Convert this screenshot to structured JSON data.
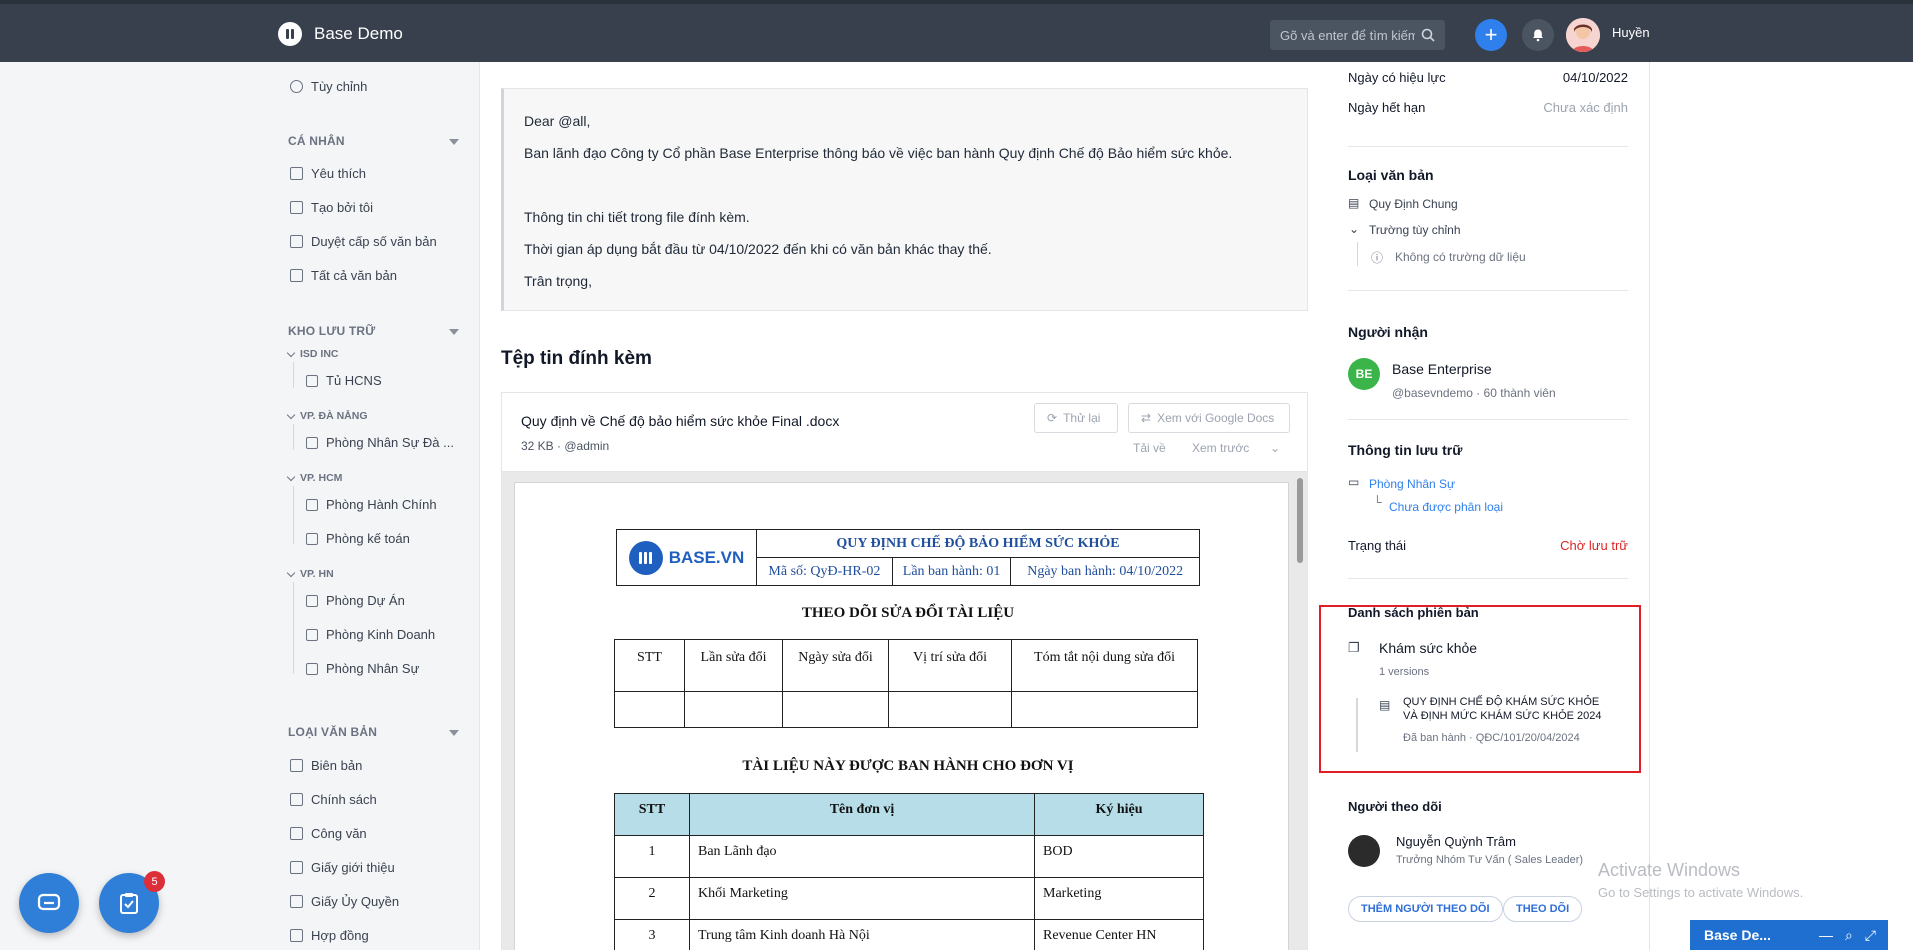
{
  "app": {
    "title": "Base Demo",
    "username": "Huyền"
  },
  "search": {
    "placeholder": "Gõ và enter để tìm kiếm"
  },
  "sidebar": {
    "top_item": "Tùy chỉnh",
    "personal": {
      "heading": "CÁ NHÂN",
      "items": [
        "Yêu thích",
        "Tạo bởi tôi",
        "Duyệt cấp số văn bản",
        "Tất cả văn bản"
      ]
    },
    "storage": {
      "heading": "KHO LƯU TRỮ",
      "groups": [
        {
          "name": "ISD INC",
          "items": [
            "Tủ HCNS"
          ]
        },
        {
          "name": "VP. ĐÀ NẴNG",
          "items": [
            "Phòng Nhân Sự Đà ..."
          ]
        },
        {
          "name": "VP. HCM",
          "items": [
            "Phòng Hành Chính",
            "Phòng kế toán"
          ]
        },
        {
          "name": "VP. HN",
          "items": [
            "Phòng Dự Án",
            "Phòng Kinh Doanh",
            "Phòng Nhân Sự"
          ]
        }
      ]
    },
    "doc_types": {
      "heading": "LOẠI VĂN BẢN",
      "items": [
        "Biên bản",
        "Chính sách",
        "Công văn",
        "Giấy giới thiệu",
        "Giấy Ủy Quyền",
        "Hợp đồng"
      ]
    }
  },
  "message": {
    "lines": [
      "Dear @all,",
      "Ban lãnh đạo Công ty Cổ phần Base Enterprise thông báo về việc ban hành Quy định Chế độ Bảo hiểm sức khỏe.",
      "",
      "Thông tin chi tiết trong file đính kèm.",
      "Thời gian áp dụng bắt đầu từ 04/10/2022 đến khi có văn bản khác thay thế.",
      "Trân trọng,"
    ]
  },
  "attachments": {
    "title": "Tệp tin đính kèm",
    "file": {
      "name": "Quy định về Chế độ bảo hiểm sức khỏe Final .docx",
      "meta": "32 KB · @admin",
      "retry_label": "Thử lại",
      "google_docs_label": "Xem với Google Docs",
      "download_label": "Tải về",
      "preview_label": "Xem trước"
    }
  },
  "document": {
    "logo_text": "BASE.VN",
    "title": "QUY ĐỊNH CHẾ ĐỘ BẢO HIỂM SỨC KHỎE",
    "code": "Mã số: QyĐ-HR-02",
    "issue_no": "Lần ban hành: 01",
    "issue_date": "Ngày ban hành: 04/10/2022",
    "tracking_heading": "THEO DÕI SỬA ĐỔI TÀI LIỆU",
    "tracking_columns": [
      "STT",
      "Lần sửa đổi",
      "Ngày sửa đổi",
      "Vị trí sửa đổi",
      "Tóm tắt nội dung sửa đổi"
    ],
    "units_heading": "TÀI LIỆU NÀY ĐƯỢC BAN HÀNH CHO ĐƠN VỊ",
    "units_columns": [
      "STT",
      "Tên đơn vị",
      "Ký hiệu"
    ],
    "units_rows": [
      [
        "1",
        "Ban Lãnh đạo",
        "BOD"
      ],
      [
        "2",
        "Khối Marketing",
        "Marketing"
      ],
      [
        "3",
        "Trung tâm Kinh doanh Hà Nội",
        "Revenue Center HN"
      ]
    ]
  },
  "details": {
    "effective_label": "Ngày có hiệu lực",
    "effective_value": "04/10/2022",
    "expiry_label": "Ngày hết hạn",
    "expiry_value": "Chưa xác định",
    "doc_type_heading": "Loại văn bản",
    "doc_type_value": "Quy Định Chung",
    "custom_field_label": "Trường tùy chỉnh",
    "no_data": "Không có trường dữ liệu",
    "recipients_heading": "Người nhận",
    "recipient_initials": "BE",
    "recipient_name": "Base Enterprise",
    "recipient_meta": "@basevndemo · 60 thành viên",
    "storage_heading": "Thông tin lưu trữ",
    "storage_folder": "Phòng Nhân Sự",
    "storage_sub": "Chưa được phân loại",
    "status_label": "Trạng thái",
    "status_value": "Chờ lưu trữ",
    "versions_heading": "Danh sách phiên bản",
    "version_group": "Khám sức khỏe",
    "version_count": "1 versions",
    "version_title_1": "QUY ĐỊNH CHẾ ĐỘ KHÁM SỨC KHỎE",
    "version_title_2": "VÀ ĐỊNH MỨC KHÁM SỨC KHỎE 2024",
    "version_meta": "Đã ban hành · QĐC/101/20/04/2024",
    "followers_heading": "Người theo dõi",
    "follower_name": "Nguyễn Quỳnh Trâm",
    "follower_role": "Trưởng Nhóm Tư Vấn ( Sales Leader)",
    "add_follower_label": "THÊM NGƯỜI THEO DÕI",
    "follow_label": "THEO DÕI"
  },
  "overlay": {
    "activate_title": "Activate Windows",
    "activate_sub": "Go to Settings to activate Windows.",
    "chat_title": "Base De...",
    "badge_count": "5"
  }
}
